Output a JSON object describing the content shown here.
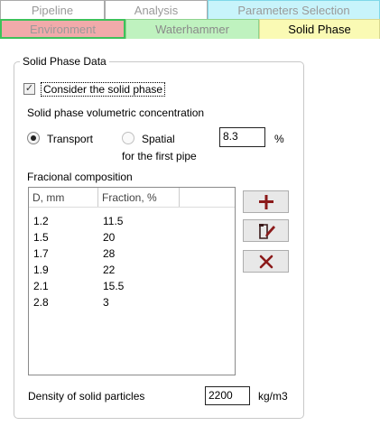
{
  "tabs_top": {
    "pipeline": "Pipeline",
    "analysis": "Analysis",
    "parameters": "Parameters Selection"
  },
  "tabs_sub": {
    "environment": "Environment",
    "waterhammer": "Waterhammer",
    "solid_phase": "Solid Phase"
  },
  "panel": {
    "title": "Solid Phase Data",
    "consider_label": "Consider the solid phase",
    "consider_checked": true,
    "concentration_label": "Solid phase volumetric concentration",
    "radio_transport": "Transport",
    "radio_spatial": "Spatial",
    "spatial_sub": "for the first pipe",
    "concentration_value": "8.3",
    "concentration_unit": "%",
    "composition_label": "Fracional composition",
    "columns": {
      "d": "D, mm",
      "fraction": "Fraction, %"
    },
    "rows": [
      {
        "d": "1.2",
        "fraction": "11.5"
      },
      {
        "d": "1.5",
        "fraction": "20"
      },
      {
        "d": "1.7",
        "fraction": "28"
      },
      {
        "d": "1.9",
        "fraction": "22"
      },
      {
        "d": "2.1",
        "fraction": "15.5"
      },
      {
        "d": "2.8",
        "fraction": "3"
      }
    ],
    "density_label": "Density of solid particles",
    "density_value": "2200",
    "density_unit": "kg/m3"
  },
  "colors": {
    "params_tab": "#c8f4fb",
    "env_tab": "#f1aaaa",
    "water_tab": "#bff2bf",
    "solid_tab": "#fafab4",
    "icon_red": "#8b1a1a"
  },
  "icons": {
    "add": "plus-icon",
    "edit": "edit-icon",
    "delete": "delete-icon"
  }
}
